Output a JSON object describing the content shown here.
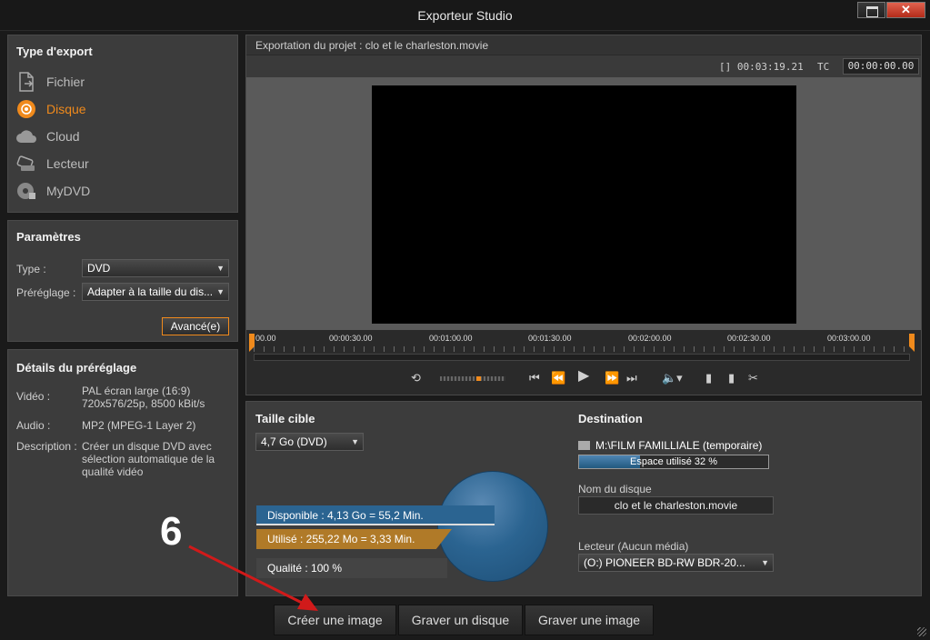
{
  "window": {
    "title": "Exporteur Studio",
    "close_glyph": "✕"
  },
  "export_type": {
    "title": "Type d'export",
    "items": [
      {
        "label": "Fichier",
        "icon": "file-export-icon",
        "active": false
      },
      {
        "label": "Disque",
        "icon": "disc-icon",
        "active": true
      },
      {
        "label": "Cloud",
        "icon": "cloud-icon",
        "active": false
      },
      {
        "label": "Lecteur",
        "icon": "device-icon",
        "active": false
      },
      {
        "label": "MyDVD",
        "icon": "mydvd-icon",
        "active": false
      }
    ]
  },
  "params": {
    "title": "Paramètres",
    "type_label": "Type :",
    "type_value": "DVD",
    "preset_label": "Préréglage :",
    "preset_value": "Adapter à la taille du dis...",
    "advanced_label": "Avancé(e)"
  },
  "details": {
    "title": "Détails du préréglage",
    "video_label": "Vidéo :",
    "video_value": "PAL écran large (16:9) 720x576/25p, 8500 kBit/s",
    "audio_label": "Audio :",
    "audio_value": "MP2 (MPEG-1 Layer 2)",
    "description_label": "Description :",
    "description_value": "Créer un disque DVD avec sélection automatique de la qualité vidéo"
  },
  "preview": {
    "project_title": "Exportation du projet : clo et le charleston.movie",
    "duration": "[] 00:03:19.21",
    "tc_label": "TC",
    "tc_value": "00:00:00.00",
    "timeline_labels": [
      "00.00",
      "00:00:30.00",
      "00:01:00.00",
      "00:01:30.00",
      "00:02:00.00",
      "00:02:30.00",
      "00:03:00.00"
    ],
    "transport_icons": [
      "loop-icon",
      "jog-icon",
      "skip-start-icon",
      "step-back-icon",
      "play-icon",
      "step-forward-icon",
      "skip-end-icon",
      "volume-icon",
      "mark-in-icon",
      "mark-out-icon",
      "split-icon"
    ]
  },
  "target": {
    "title": "Taille cible",
    "size_value": "4,7 Go (DVD)",
    "available": "Disponible : 4,13 Go = 55,2 Min.",
    "used": "Utilisé : 255,22 Mo = 3,33 Min.",
    "quality": "Qualité :   100 %",
    "used_fraction": 0.06
  },
  "destination": {
    "title": "Destination",
    "path": "M:\\FILM FAMILLIALE (temporaire)",
    "space_used": "Espace utilisé 32 %",
    "space_used_percent": 32,
    "disc_name_label": "Nom du disque",
    "disc_name_value": "clo et le charleston.movie",
    "drive_label": "Lecteur  (Aucun média)",
    "drive_value": "(O:) PIONEER BD-RW   BDR-20..."
  },
  "actions": {
    "create_image": "Créer une image",
    "burn_disc": "Graver un disque",
    "burn_image": "Graver une image"
  },
  "annotation": {
    "step": "6"
  },
  "colors": {
    "accent": "#f08a1c",
    "available_bar": "#2b6491",
    "used_bar": "#b07a28",
    "annotation_arrow": "#d11a1a"
  }
}
